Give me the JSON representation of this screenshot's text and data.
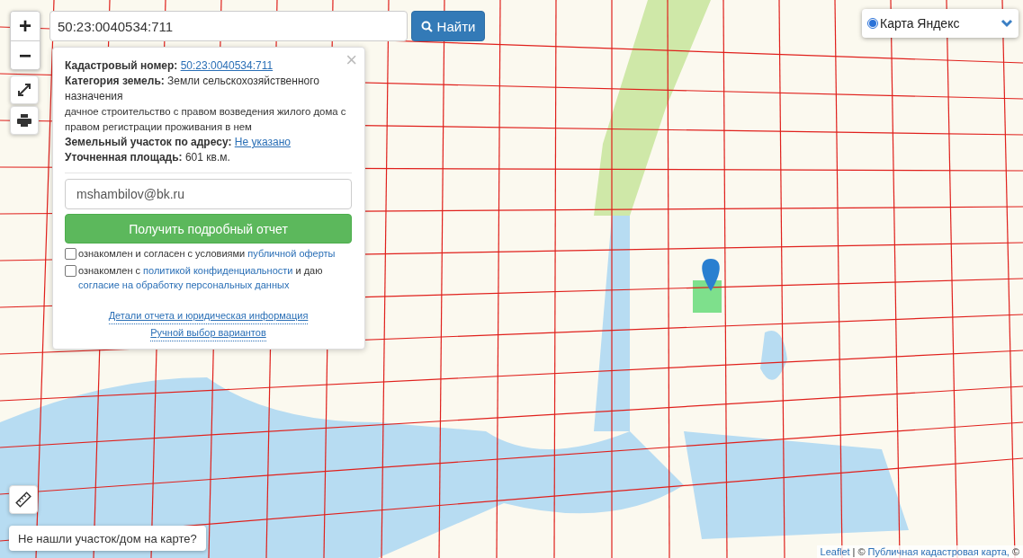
{
  "search": {
    "value": "50:23:0040534:711",
    "button": "Найти"
  },
  "zoom": {
    "in": "+",
    "out": "−"
  },
  "layer_select": {
    "label": "Карта Яндекс",
    "selected": true
  },
  "popup": {
    "close": "×",
    "cadastral": {
      "label": "Кадастровый номер:",
      "value": "50:23:0040534:711"
    },
    "category": "**Категория земель:** Земли сельскохозяйственного назначения",
    "usage": "дачное строительство с правом возведения жилого дома с правом регистрации проживания в нем",
    "address": {
      "label": "Земельный участок по адресу:",
      "value": "Не указано"
    },
    "area": "**Уточненная площадь:** 601 кв.м.",
    "email": {
      "value": "mshambilov@bk.ru"
    },
    "submit": "Получить подробный отчет",
    "agreements": [
      {
        "checked": false,
        "segments": [
          {
            "text": "ознакомлен и согласен с условиями ",
            "link": false
          },
          {
            "text": "публичной оферты",
            "link": true
          }
        ]
      },
      {
        "checked": false,
        "segments": [
          {
            "text": "ознакомлен с ",
            "link": false
          },
          {
            "text": "политикой конфиденциальности",
            "link": true
          },
          {
            "text": " и даю ",
            "link": false
          },
          {
            "text": "согласие на обработку персональных данных",
            "link": true
          }
        ]
      }
    ],
    "links": [
      "Детали отчета и юридическая информация",
      "Ручной выбор вариантов"
    ]
  },
  "not_found_button": "Не нашли участок/дом на карте?",
  "attribution": {
    "leaflet": "Leaflet",
    "separator": "|",
    "prefix": "©",
    "source": "Публичная кадастровая карта,",
    "suffix": "©"
  }
}
